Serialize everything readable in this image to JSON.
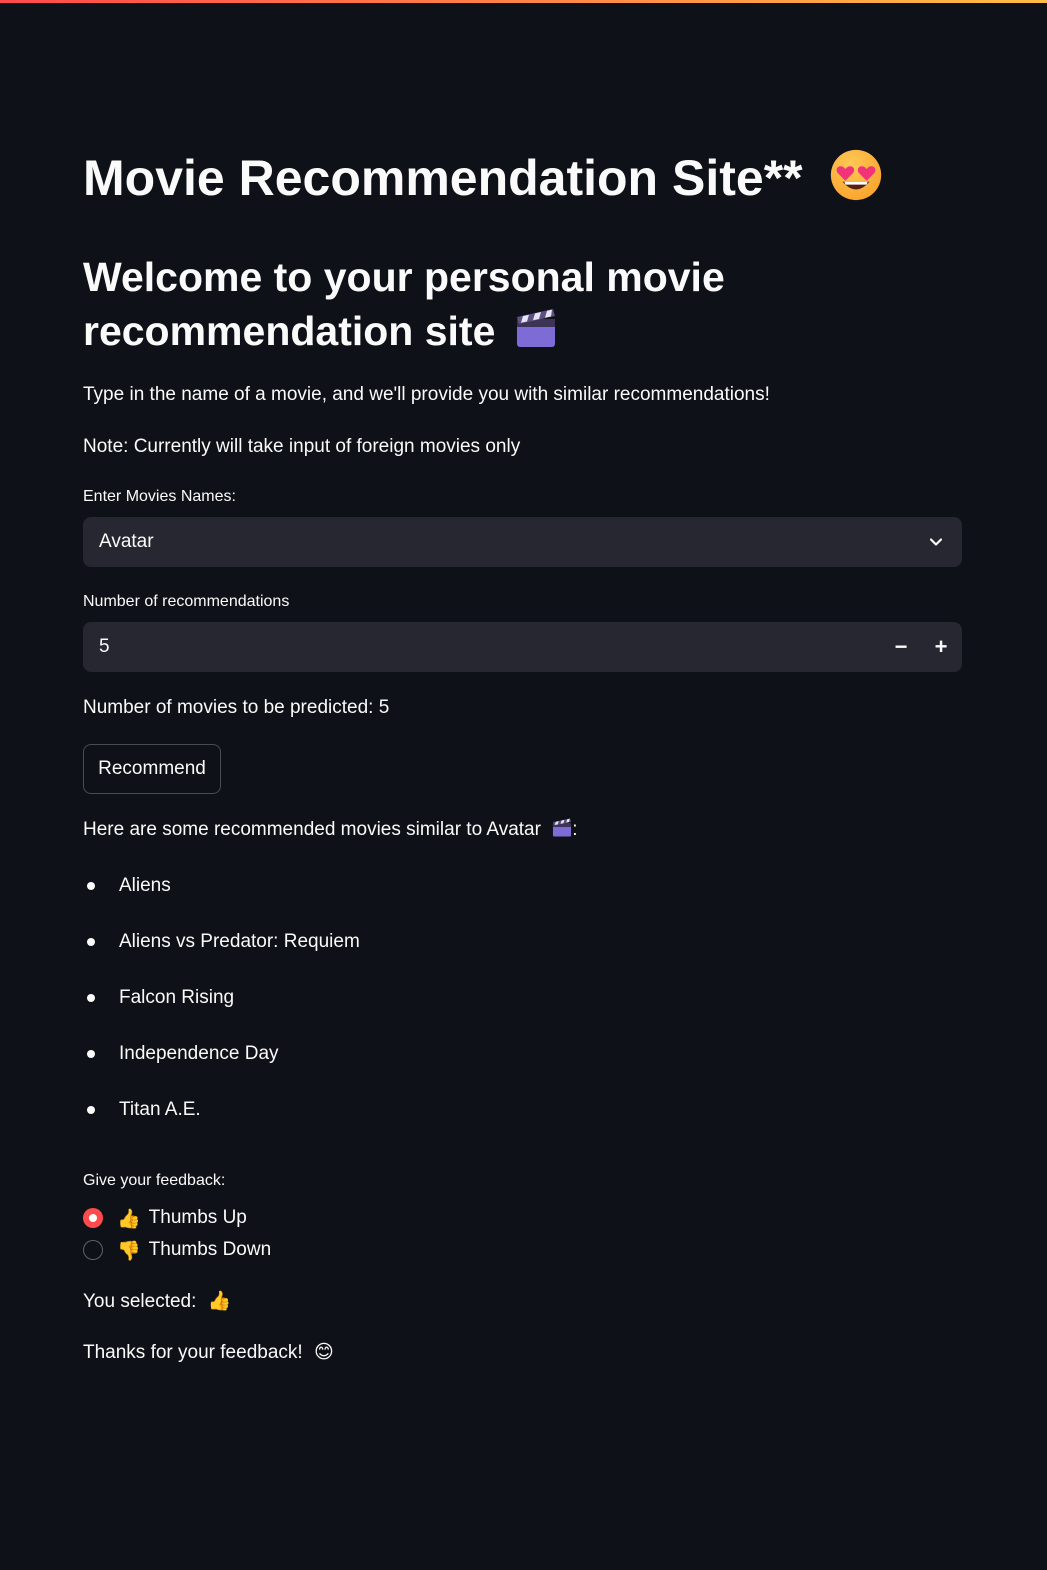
{
  "theme": {
    "background": "#0e1117",
    "accent": "#ff4b4b",
    "field_background": "#262730",
    "text": "#fafafa"
  },
  "title": {
    "text": "Movie Recommendation Site**",
    "emoji_icon": "heart-eyes-emoji-icon"
  },
  "subheader": {
    "text": "Welcome to your personal movie recommendation site",
    "emoji_icon": "clapper-board-icon"
  },
  "intro": {
    "line1": "Type in the name of a movie, and we'll provide you with similar recommendations!",
    "line2": "Note: Currently will take input of foreign movies only"
  },
  "movie_select": {
    "label": "Enter Movies Names:",
    "value": "Avatar"
  },
  "num_input": {
    "label": "Number of recommendations",
    "value": "5",
    "minus": "−",
    "plus": "+"
  },
  "predicted_text": "Number of movies to be predicted: 5",
  "recommend_button": "Recommend",
  "results": {
    "heading_prefix": "Here are some recommended movies similar to Avatar",
    "heading_suffix": ":",
    "items": [
      "Aliens",
      "Aliens vs Predator: Requiem",
      "Falcon Rising",
      "Independence Day",
      "Titan A.E."
    ]
  },
  "feedback": {
    "label": "Give your feedback:",
    "options": [
      {
        "emoji": "👍",
        "label": "Thumbs Up",
        "selected": true
      },
      {
        "emoji": "👎",
        "label": "Thumbs Down",
        "selected": false
      }
    ],
    "selected_text": "You selected:",
    "selected_emoji": "👍",
    "thanks_text": "Thanks for your feedback!",
    "thanks_emoji": "😊"
  }
}
